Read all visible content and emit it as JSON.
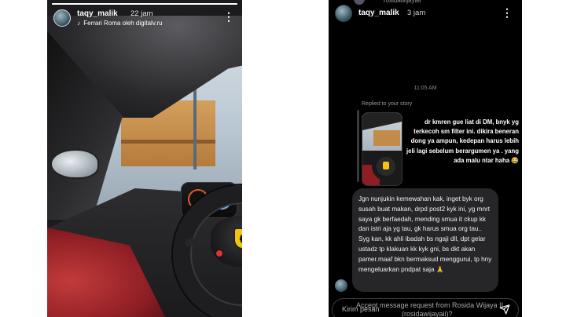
{
  "story": {
    "username": "taqy_malik",
    "time": "22 jam",
    "music": "Ferrari Roma oleh digitalv.ru",
    "progress": 1.0
  },
  "dm": {
    "top_username": "rosidawijayaii",
    "username": "taqy_malik",
    "time": "3 jam",
    "timestamp": "11:05 AM",
    "replied_label": "Replied to your story",
    "my_message": "dr kmren gue liat di DM, bnyk yg terkecoh sm filter ini. dikira beneran dong ya ampun, kedepan harus lebih jeli lagi sebelum berargumen ya . yang ada malu ntar haha 😂",
    "their_message": "Jgn nunjukin kemewahan kak, inget byk org susah buat makan, drpd post2 kyk ini, yg mnrt saya gk berfaedah, mending smua it ckup kk dan istri aja yg tau, gk harus smua org tau.. Syg kan, kk ahli ibadah bs ngaji dll, dpt gelar ustadz tp klakuan kk kyk gni, bs dkt akan pamer.maaf bkn bermaksud menggurui, tp hny mengeluarkan pndpat saja 🙏",
    "input_placeholder": "Kirim pesan",
    "request_text": "Accept message request from Rosida Wijaya II",
    "request_sub": "(rosidawijayaii)?"
  },
  "icons": {
    "more": "more-vertical-icon",
    "music": "music-icon",
    "send": "send-icon"
  },
  "colors": {
    "dm_background": "#000000",
    "bubble": "#262628",
    "ferrari_badge": "#f1c40f",
    "seat_red": "#8e1e24"
  }
}
